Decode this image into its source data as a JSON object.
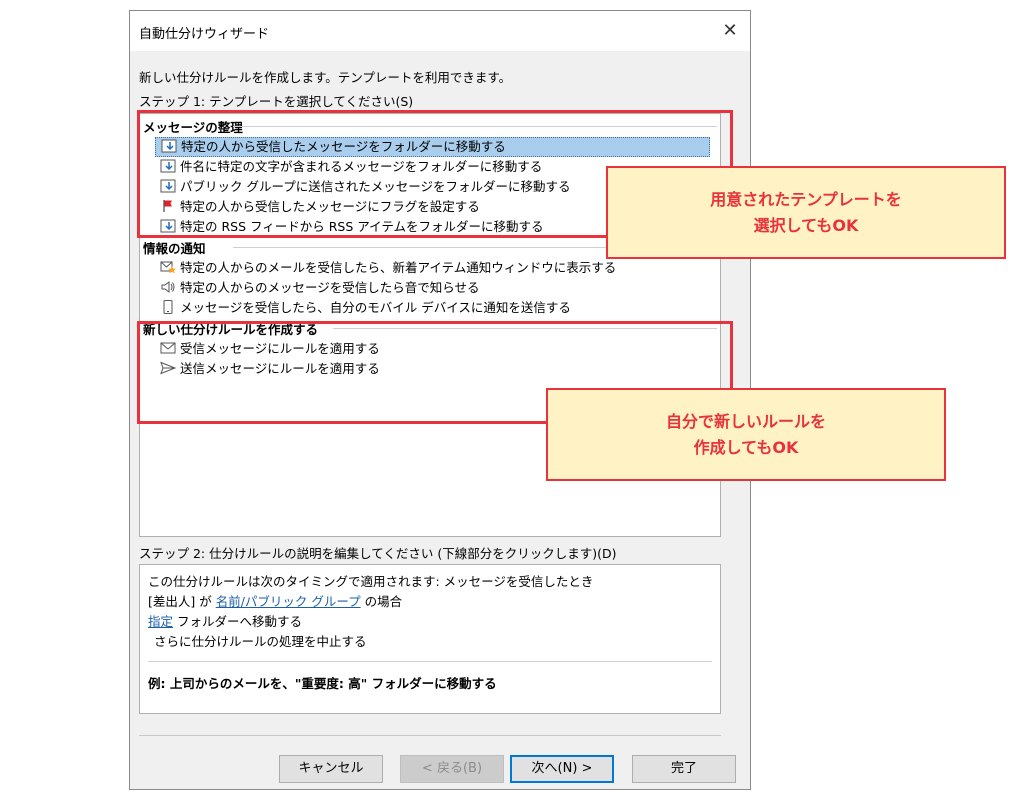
{
  "window": {
    "title": "自動仕分けウィザード",
    "close_symbol": "✕"
  },
  "intro": "新しい仕分けルールを作成します。テンプレートを利用できます。",
  "step1": "ステップ 1: テンプレートを選択してください(S)",
  "groups": [
    {
      "label": "メッセージの整理",
      "items": [
        {
          "label": "特定の人から受信したメッセージをフォルダーに移動する",
          "icon": "move-to-folder-icon"
        },
        {
          "label": "件名に特定の文字が含まれるメッセージをフォルダーに移動する",
          "icon": "move-to-folder-icon"
        },
        {
          "label": "パブリック グループに送信されたメッセージをフォルダーに移動する",
          "icon": "move-to-folder-icon"
        },
        {
          "label": "特定の人から受信したメッセージにフラグを設定する",
          "icon": "flag-icon"
        },
        {
          "label": "特定の RSS フィードから RSS アイテムをフォルダーに移動する",
          "icon": "move-to-folder-icon"
        }
      ]
    },
    {
      "label": "情報の通知",
      "items": [
        {
          "label": "特定の人からのメールを受信したら、新着アイテム通知ウィンドウに表示する",
          "icon": "new-item-alert-icon"
        },
        {
          "label": "特定の人からのメッセージを受信したら音で知らせる",
          "icon": "speaker-icon"
        },
        {
          "label": "メッセージを受信したら、自分のモバイル デバイスに通知を送信する",
          "icon": "mobile-device-icon"
        }
      ]
    },
    {
      "label": "新しい仕分けルールを作成する",
      "items": [
        {
          "label": "受信メッセージにルールを適用する",
          "icon": "envelope-icon"
        },
        {
          "label": "送信メッセージにルールを適用する",
          "icon": "send-icon"
        }
      ]
    }
  ],
  "step2": "ステップ 2: 仕分けルールの説明を編集してください (下線部分をクリックします)(D)",
  "description": {
    "line1": "この仕分けルールは次のタイミングで適用されます: メッセージを受信したとき",
    "line2_pre": "[差出人] が ",
    "line2_link": "名前/パブリック グループ",
    "line2_post": " の場合",
    "line3_link": "指定",
    "line3_post": " フォルダーへ移動する",
    "line4": "さらに仕分けルールの処理を中止する",
    "example": "例: 上司からのメールを、\"重要度: 高\" フォルダーに移動する"
  },
  "buttons": {
    "cancel": "キャンセル",
    "back": "< 戻る(B)",
    "next": "次へ(N) >",
    "finish": "完了"
  },
  "callouts": {
    "template": {
      "line1": "用意されたテンプレートを",
      "line2": "選択してもOK"
    },
    "new_rule": {
      "line1": "自分で新しいルールを",
      "line2": "作成してもOK"
    }
  },
  "colors": {
    "highlight": "#e8323c",
    "callout_bg": "#fff2c4",
    "selection": "#a9cdec",
    "link": "#1b5fa8"
  }
}
